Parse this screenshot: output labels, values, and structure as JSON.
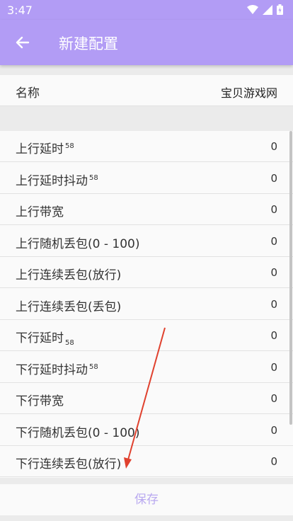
{
  "status": {
    "time": "3:47"
  },
  "header": {
    "title": "新建配置"
  },
  "name_row": {
    "label": "名称",
    "value": "宝贝游戏网"
  },
  "rows": [
    {
      "label": "上行延时",
      "mark": "58",
      "value": "0"
    },
    {
      "label": "上行延时抖动",
      "mark": "58",
      "value": "0"
    },
    {
      "label": "上行带宽",
      "mark": "",
      "value": "0"
    },
    {
      "label": "上行随机丢包(0 - 100)",
      "mark": "",
      "value": "0"
    },
    {
      "label": "上行连续丢包(放行)",
      "mark": "",
      "value": "0"
    },
    {
      "label": "上行连续丢包(丢包)",
      "mark": "",
      "value": "0"
    },
    {
      "label": "下行延时",
      "mark": "58",
      "value": "0"
    },
    {
      "label": "下行延时抖动",
      "mark": "58",
      "value": "0"
    },
    {
      "label": "下行带宽",
      "mark": "",
      "value": "0"
    },
    {
      "label": "下行随机丢包(0 - 100)",
      "mark": "",
      "value": "0"
    },
    {
      "label": "下行连续丢包(放行)",
      "mark": "",
      "value": "0"
    }
  ],
  "footer": {
    "save_label": "保存"
  },
  "colors": {
    "primary": "#b29cf5",
    "save_text": "#b9a9f0",
    "annotation": "#e0412e"
  }
}
